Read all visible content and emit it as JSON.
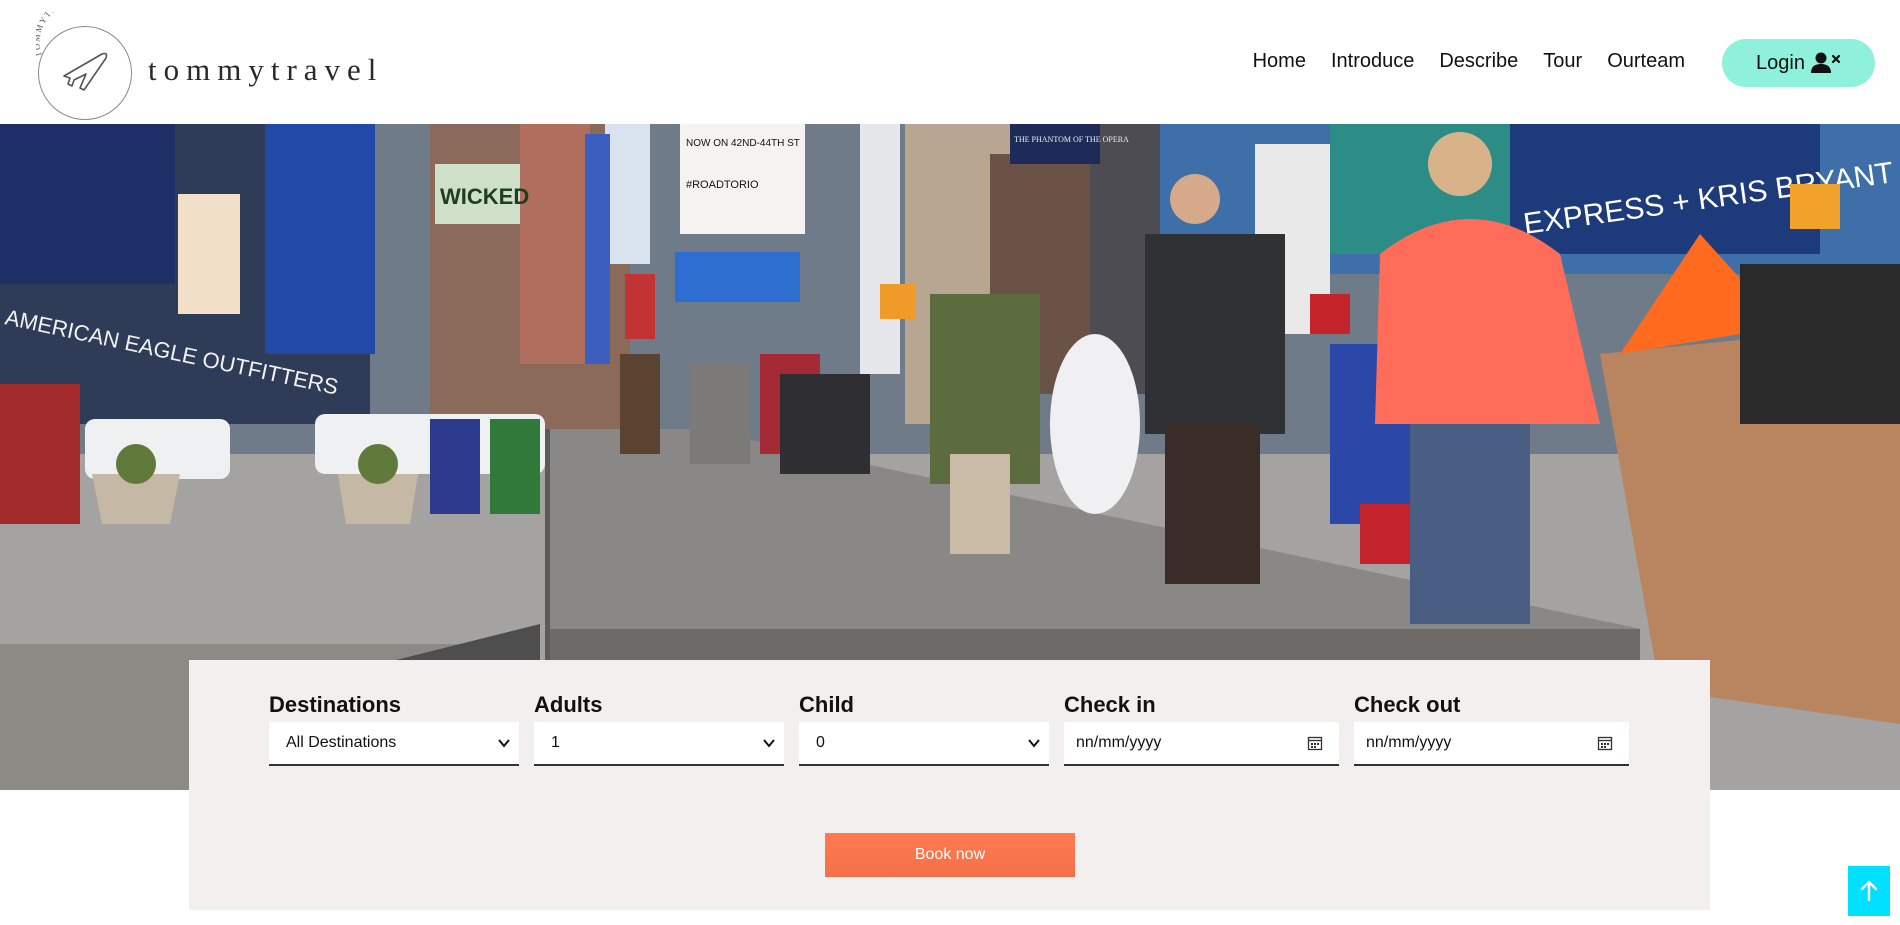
{
  "brand": {
    "name": "tommytravel",
    "arc_text": "TOMMYTRAVEL"
  },
  "nav": {
    "items": [
      {
        "label": "Home"
      },
      {
        "label": "Introduce"
      },
      {
        "label": "Describe"
      },
      {
        "label": "Tour"
      },
      {
        "label": "Ourteam"
      }
    ],
    "login_label": "Login",
    "login_icon": "user-x-icon"
  },
  "hero": {
    "billboards": {
      "now_on": "NOW ON 42ND-44TH ST",
      "roadtorio": "#ROADTORIO",
      "wicked": "WICKED",
      "phantom": "THE PHANTOM OF THE OPERA",
      "express": "EXPRESS + KRIS BRYANT",
      "american_eagle": "AMERICAN EAGLE OUTFITTERS"
    }
  },
  "booking": {
    "destinations": {
      "label": "Destinations",
      "value": "All Destinations"
    },
    "adults": {
      "label": "Adults",
      "value": "1"
    },
    "child": {
      "label": "Child",
      "value": "0"
    },
    "check_in": {
      "label": "Check in",
      "placeholder": "nn/mm/yyyy"
    },
    "check_out": {
      "label": "Check out",
      "placeholder": "nn/mm/yyyy"
    },
    "book_button": "Book now"
  },
  "colors": {
    "login_bg": "#8ff0dc",
    "book_button": "#f47049",
    "scroll_top": "#00e0ff",
    "form_bg": "#f4efef"
  }
}
